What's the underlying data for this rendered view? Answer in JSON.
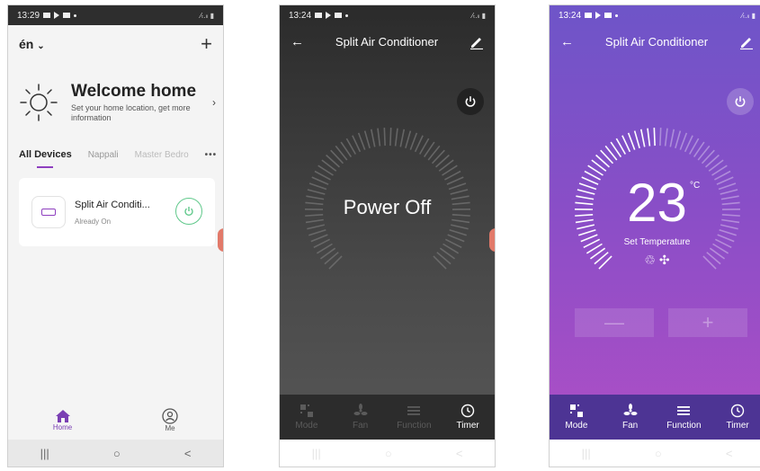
{
  "phone1": {
    "status": {
      "time": "13:29",
      "right": "⁄ₜ.ₗₗ ▮"
    },
    "home_selector": "én",
    "welcome_title": "Welcome home",
    "welcome_sub": "Set your home location, get more information",
    "tabs": [
      "All Devices",
      "Nappali",
      "Master Bedro"
    ],
    "device": {
      "name": "Split Air Conditi...",
      "status": "Already On"
    },
    "nav": {
      "home": "Home",
      "me": "Me"
    },
    "sysnav": {
      "recents": "|||",
      "home": "○",
      "back": "<"
    }
  },
  "phone2": {
    "status": {
      "time": "13:24",
      "right": "⁄ₜ.ₗₗ ▮"
    },
    "title": "Split Air Conditioner",
    "power_state": "Power Off",
    "tabs": [
      "Mode",
      "Fan",
      "Function",
      "Timer"
    ]
  },
  "phone3": {
    "status": {
      "time": "13:24",
      "right": "⁄ₜ.ₗₗ ▮"
    },
    "title": "Split Air Conditioner",
    "temperature": "23",
    "unit": "°C",
    "temp_label": "Set Temperature",
    "mode_icons": "♲ ✣",
    "minus": "—",
    "plus": "+",
    "tabs": [
      "Mode",
      "Fan",
      "Function",
      "Timer"
    ]
  },
  "colors": {
    "accent": "#8e3fbf",
    "power_green": "#5fc88a",
    "purple_top": "#6e55c8",
    "purple_bottom": "#b24fc6"
  }
}
